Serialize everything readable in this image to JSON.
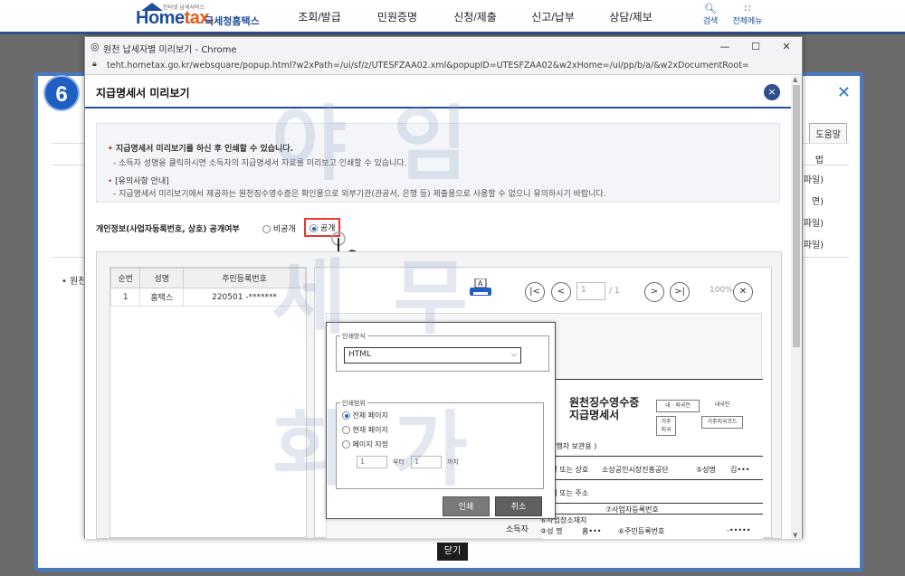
{
  "header": {
    "logo_mini": "인터넷 납세서비스",
    "logo_brand_a": "Home",
    "logo_brand_b": "tax.",
    "logo_sub": "국세청홈택스",
    "nav": [
      "조회/발급",
      "민원증명",
      "신청/제출",
      "신고/납부",
      "상담/제보"
    ],
    "search_label": "검색",
    "all_menu_label": "전체메뉴"
  },
  "step_number": "6",
  "back_panel": {
    "help_label": "도움말",
    "col_head": "법",
    "rows": [
      "h파일)",
      "면)",
      "h파일)",
      "h파일)"
    ],
    "note": "• 원천"
  },
  "window": {
    "title": "원천 납세자별 미리보기 - Chrome",
    "controls": [
      "—",
      "☐",
      "✕"
    ],
    "url": "teht.hometax.go.kr/websquare/popup.html?w2xPath=/ui/sf/z/UTESFZAA02.xml&popupID=UTESFZAA02&w2xHome=/ui/pp/b/a/&w2xDocumentRoot="
  },
  "popup": {
    "title": "지급명세서 미리보기",
    "close_symbol": "×",
    "info": {
      "line1": "지급명세서 미리보기를 하신 후 인쇄할 수 있습니다.",
      "line2": "- 소득자 성명을 클릭하시면 소득자의 지급명세서 자료를 미리보고 인쇄할 수 있습니다.",
      "line3": "[유의사항 안내]",
      "line4": "- 지급명세서 미리보기에서 제공하는 원천징수영수증은 확인용으로 외부기관(관공서, 은행 등) 제출용으로 사용할 수 없으니 유의하시기 바랍니다."
    },
    "privacy": {
      "label": "개인정보(사업자등록번호, 상호) 공개여부",
      "option_private": "비공개",
      "option_public": "공개",
      "selected": "공개"
    }
  },
  "list": {
    "headers": [
      "순번",
      "성명",
      "주민등록번호"
    ],
    "rows": [
      {
        "no": "1",
        "name": "홈택스",
        "id": "220501 -*******"
      }
    ]
  },
  "viewer": {
    "page_current": "1",
    "page_total": "/ 1",
    "zoom": "100%"
  },
  "document": {
    "title_line1": "원천징수영수증",
    "title_line2": "지급명세서",
    "box1": "내 · 외국인",
    "box1b": "내국인",
    "box2": "거주\n지국",
    "box2b": "거주지국코드",
    "issuer_line": "발행자 보관용    )",
    "row1": "인명 또는 상호",
    "row1b": "소상공인시장진흥공단",
    "row1c": "⑤성명",
    "row1d": "김•••",
    "row2": "재지 또는 주소",
    "row3": "⑦사업자등록번호",
    "earner": "소득자",
    "earner_row1": "⑥사업장소재지",
    "earner_row2": "⑨성       명",
    "earner_name": "홈•••",
    "earner_id": "⑥주민등록번호",
    "earner_id_val": "-•••••"
  },
  "print_dialog": {
    "method_legend": "인쇄방식",
    "method_value": "HTML",
    "range_legend": "인쇄범위",
    "opt_all": "전체 페이지",
    "opt_current": "현재 페이지",
    "opt_specify": "페이지 지정",
    "from_value": "1",
    "from_label": "부터",
    "to_value": "1",
    "to_label": "까지",
    "print_label": "인쇄",
    "cancel_label": "취소"
  },
  "bottom": {
    "close_label": "닫기"
  },
  "watermark": {
    "w1": "야 임",
    "w2": "세 무",
    "w3": "회 가"
  },
  "colors": {
    "brand_blue": "#1f4e9c",
    "highlight_red": "#e53935",
    "header_rule": "#2b4f8a"
  }
}
